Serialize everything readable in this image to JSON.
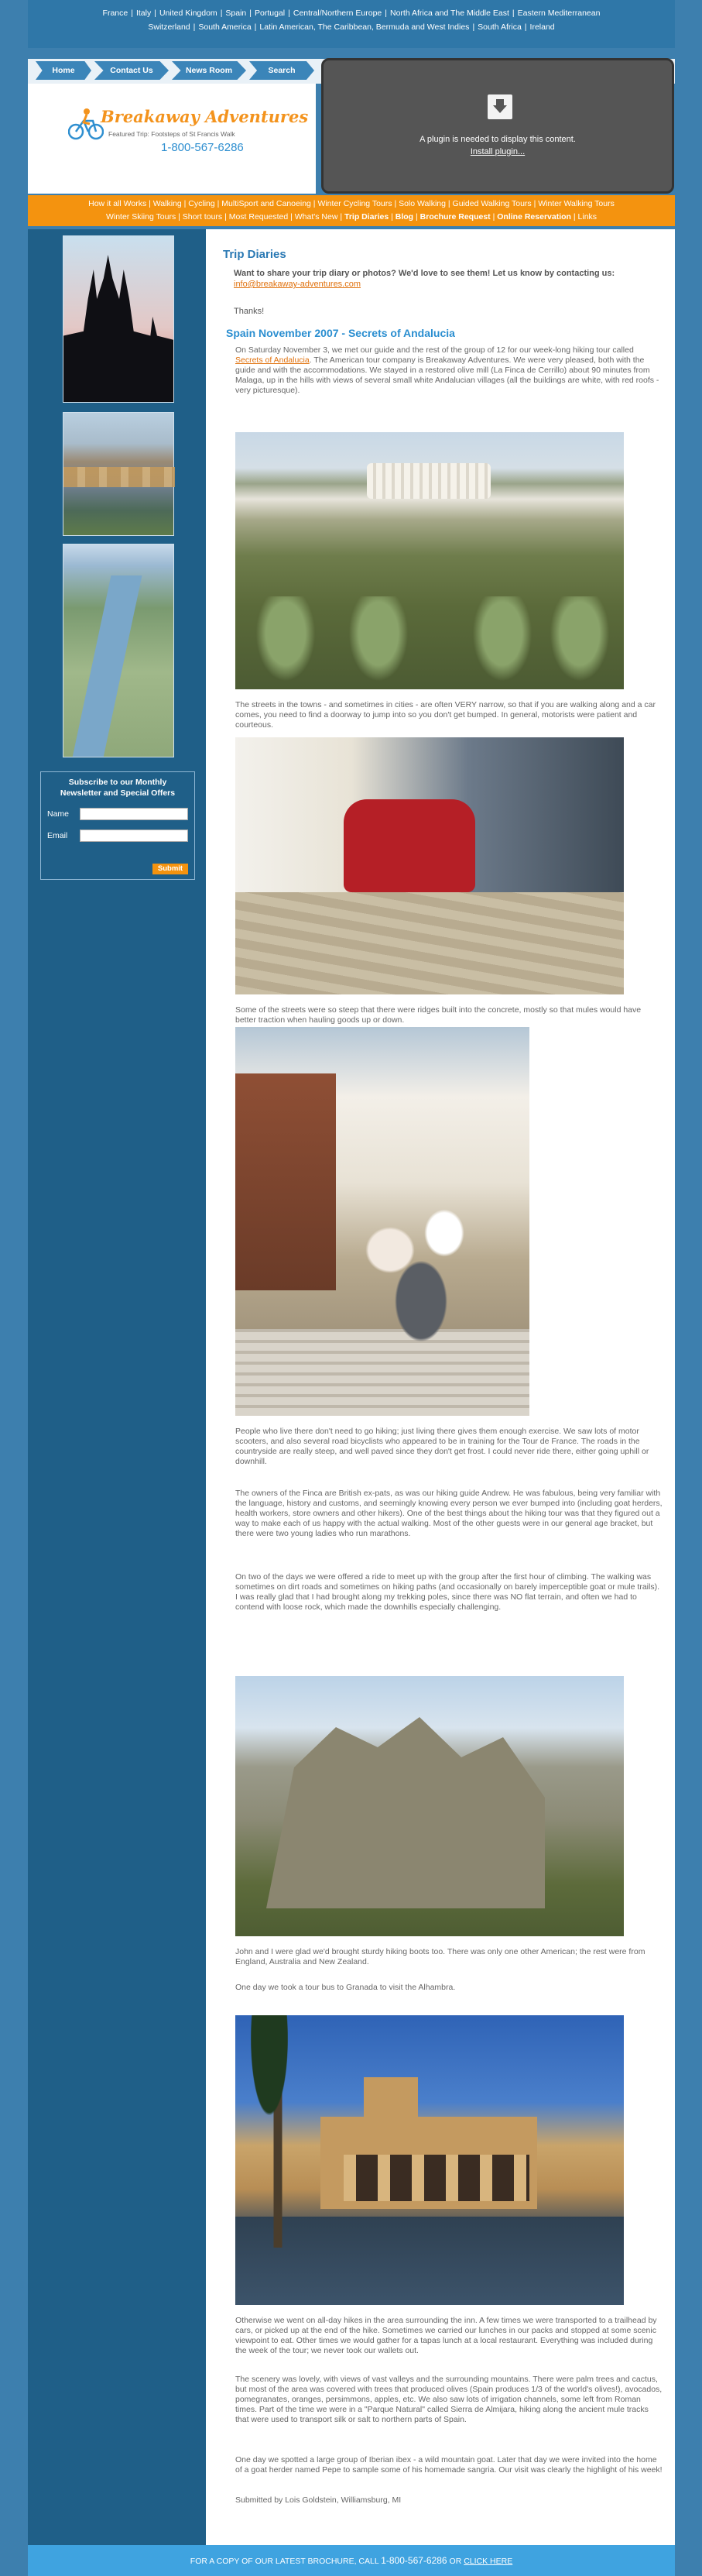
{
  "geo_nav": {
    "line1": [
      "France",
      "Italy",
      "United Kingdom",
      "Spain",
      "Portugal",
      "Central/Northern Europe",
      "North Africa and The Middle East",
      "Eastern Mediterranean"
    ],
    "line2": [
      "Switzerland",
      "South America",
      "Latin American, The Caribbean, Bermuda and West Indies",
      "South Africa",
      "Ireland"
    ]
  },
  "main_nav": [
    {
      "label": "Home"
    },
    {
      "label": "Contact Us"
    },
    {
      "label": "News Room"
    },
    {
      "label": "Search"
    }
  ],
  "logo": {
    "brand": "Breakaway Adventures",
    "tagline": "Featured Trip: Footsteps of St Francis Walk",
    "phone": "1-800-567-6286"
  },
  "plugin": {
    "message": "A plugin is needed to display this content.",
    "install": "Install plugin..."
  },
  "activity_nav": {
    "line1": [
      "How it all Works",
      "Walking",
      "Cycling",
      "MultiSport and Canoeing",
      "Winter Cycling Tours",
      "Solo Walking",
      "Guided Walking Tours",
      "Winter Walking Tours"
    ],
    "line2_normal": [
      "Winter Skiing Tours",
      "Short tours",
      "Most Requested",
      "What's New"
    ],
    "line2_bold": [
      "Trip Diaries",
      "Blog",
      "Brochure Request",
      "Online Reservation"
    ],
    "line2_end": "Links"
  },
  "newsletter": {
    "title": "Subscribe to our Monthly Newsletter and Special Offers",
    "name_label": "Name",
    "email_label": "Email",
    "submit": "Submit"
  },
  "content": {
    "heading": "Trip Diaries",
    "intro": "Want to share your trip diary or photos? We'd love to see them! Let us know by contacting us:",
    "email": "info@breakaway-adventures.com",
    "thanks": "Thanks!",
    "subheading": "Spain November 2007 - Secrets of Andalucia",
    "p1_before": "On Saturday November 3, we met our guide and the rest of the group of 12 for our week-long hiking tour called ",
    "p1_link": "Secrets of Andalucia",
    "p1_after": ". The American tour company is Breakaway Adventures. We were very pleased, both with the guide and with the accommodations. We stayed in a restored olive mill (La Finca de Cerrillo) about 90 minutes from Malaga, up in the hills with views of several small white Andalucian villages (all the buildings are white, with red roofs - very picturesque).",
    "p2": "The streets in the towns - and sometimes in cities - are often VERY narrow, so that if you are walking along and a car comes, you need to find a doorway to jump into so you don't get bumped. In general, motorists were patient and courteous.",
    "p3": "Some of the streets were so steep that there were ridges built into the concrete, mostly so that mules would have better traction when hauling goods up or down.",
    "p4": "People who live there don't need to go hiking; just living there gives them enough exercise. We saw lots of motor scooters, and also several road bicyclists who appeared to be in training for the Tour de France. The roads in the countryside are really steep, and well paved since they don't get frost. I could never ride there, either going uphill or downhill.",
    "p5": "The owners of the Finca are British ex-pats, as was our hiking guide Andrew. He was fabulous, being very familiar with the language, history and customs, and seemingly knowing every person we ever bumped into (including goat herders, health workers, store owners and other hikers). One of the best things about the hiking tour was that they figured out a way to make each of us happy with the actual walking. Most of the other guests were in our general age bracket, but there were two young ladies who run marathons.",
    "p6": "On two of the days we were offered a ride to meet up with the group after the first hour of climbing. The walking was sometimes on dirt roads and sometimes on hiking paths (and occasionally on barely imperceptible goat or mule trails). I was really glad that I had brought along my trekking poles, since there was NO flat terrain, and often we had to contend with loose rock, which made the downhills especially challenging.",
    "p7": "John and I were glad we'd brought sturdy hiking boots too. There was only one other American; the rest were from England, Australia and New Zealand.",
    "p8": "One day we took a tour bus to Granada to visit the Alhambra.",
    "p9": "Otherwise we went on all-day hikes in the area surrounding the inn.  A few times we were transported to a trailhead by cars, or picked up at the end of the hike. Sometimes we carried our lunches in our packs and stopped at some scenic viewpoint to eat. Other times we would gather for a tapas lunch at a local restaurant. Everything was included during the week of the tour; we never took our wallets out.",
    "p10": "The scenery was lovely, with views of vast valleys and the surrounding mountains. There were palm trees and cactus, but most of the area was covered with trees that produced olives (Spain produces 1/3 of the world's olives!), avocados, pomegranates, oranges, persimmons, apples, etc. We also saw lots of irrigation channels, some left from Roman times. Part of the time we were in a \"Parque Natural\" called Sierra de Almijara, hiking along the ancient mule tracks that were used to transport silk or salt to northern parts of Spain.",
    "p11": "One day we spotted a large group of Iberian ibex - a wild mountain goat. Later that day we were invited into the home of a goat herder named Pepe to sample some of his homemade sangria. Our visit was clearly the highlight of his week!",
    "signature": "Submitted by Lois Goldstein, Williamsburg, MI"
  },
  "footer": {
    "text": "FOR A COPY OF OUR LATEST BROCHURE, CALL",
    "phone": "1-800-567-6286",
    "or": "OR",
    "link": "CLICK HERE"
  },
  "colors": {
    "page_bg": "#3d7fae",
    "sidebar": "#1f5f88",
    "orange_bar": "#f4930f",
    "heading_blue": "#2a79b4",
    "link_orange": "#e0710d",
    "footer": "#3fa3e0"
  }
}
